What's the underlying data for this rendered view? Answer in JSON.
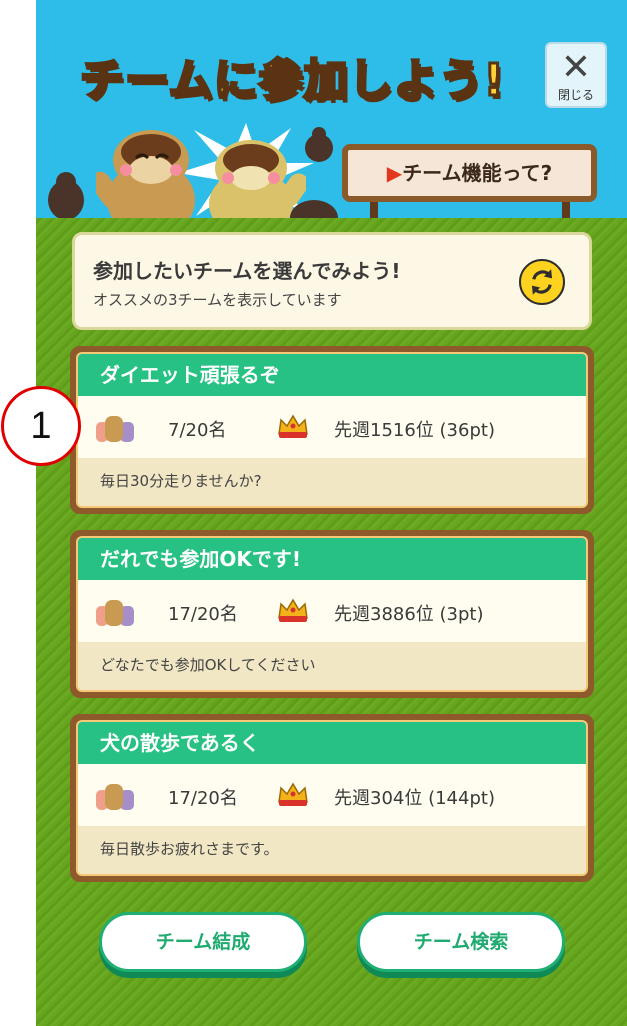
{
  "header": {
    "title": "チームに参加しよう!",
    "close_icon": "✕",
    "close_label": "閉じる",
    "info_sign": "チーム機能って?",
    "info_arrow": "▶"
  },
  "intro": {
    "title": "参加したいチームを選んでみよう!",
    "subtitle": "オススメの3チームを表示しています",
    "refresh_icon": "refresh-icon"
  },
  "teams": [
    {
      "name": "ダイエット頑張るぞ",
      "members": "7/20名",
      "rank": "先週1516位 (36pt)",
      "description": "毎日30分走りませんか?"
    },
    {
      "name": "だれでも参加OKです!",
      "members": "17/20名",
      "rank": "先週3886位 (3pt)",
      "description": "どなたでも参加OKしてください"
    },
    {
      "name": "犬の散歩であるく",
      "members": "17/20名",
      "rank": "先週304位 (144pt)",
      "description": "毎日散歩お疲れさまです。"
    }
  ],
  "actions": {
    "create": "チーム結成",
    "search": "チーム検索"
  },
  "annotation": {
    "marker": "1"
  },
  "colors": {
    "sky": "#2ebde8",
    "grass": "#67a51f",
    "team_header": "#26c183",
    "card_frame": "#8e5a2c",
    "title_fill": "#ffd23a",
    "accent_red": "#e2371d"
  }
}
